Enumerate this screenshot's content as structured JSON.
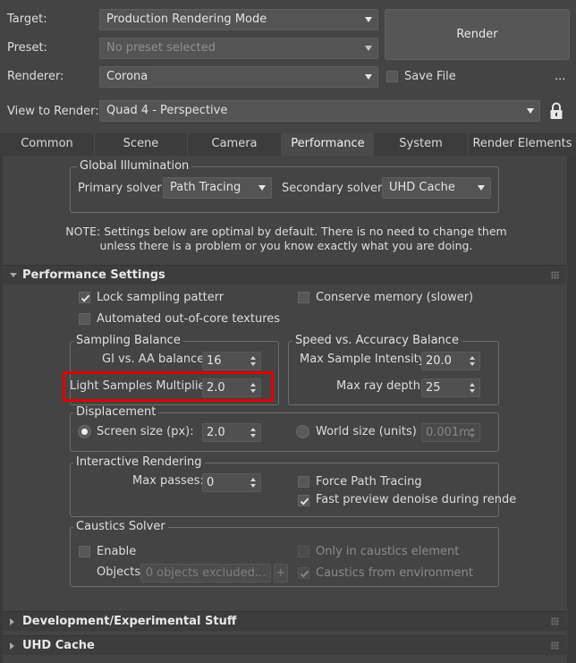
{
  "header": {
    "target_label": "Target:",
    "target_value": "Production Rendering Mode",
    "preset_label": "Preset:",
    "preset_value": "No preset selected",
    "renderer_label": "Renderer:",
    "renderer_value": "Corona",
    "view_label": "View to Render:",
    "view_value": "Quad 4 - Perspective",
    "render_button": "Render",
    "save_file_label": "Save File",
    "more_button": "..."
  },
  "tabs": [
    {
      "label": "Common",
      "active": false
    },
    {
      "label": "Scene",
      "active": false
    },
    {
      "label": "Camera",
      "active": false
    },
    {
      "label": "Performance",
      "active": true
    },
    {
      "label": "System",
      "active": false
    },
    {
      "label": "Render Elements",
      "active": false
    }
  ],
  "global_illumination": {
    "title": "Global Illumination",
    "primary_label": "Primary solver:",
    "primary_value": "Path Tracing",
    "secondary_label": "Secondary solver:",
    "secondary_value": "UHD Cache",
    "note_line1": "NOTE: Settings below are optimal by default. There is no need to change them",
    "note_line2": "unless there is a problem or you know exactly what you are doing."
  },
  "performance_settings": {
    "title": "Performance Settings",
    "lock_sampling_label": "Lock sampling patterr",
    "lock_sampling_checked": true,
    "conserve_memory_label": "Conserve memory (slower)",
    "conserve_memory_checked": false,
    "out_of_core_label": "Automated out-of-core textures",
    "out_of_core_checked": false,
    "sampling_balance": {
      "title": "Sampling Balance",
      "gi_aa_label": "GI vs. AA balance:",
      "gi_aa_value": "16",
      "light_samples_label": "Light Samples Multiplier:",
      "light_samples_value": "2.0"
    },
    "speed_accuracy": {
      "title": "Speed vs. Accuracy Balance",
      "max_sample_label": "Max Sample Intensity:",
      "max_sample_value": "20.0",
      "max_ray_label": "Max ray depth:",
      "max_ray_value": "25"
    },
    "displacement": {
      "title": "Displacement",
      "screen_size_label": "Screen size (px):",
      "screen_size_value": "2.0",
      "world_size_label": "World size (units)",
      "world_size_value": "0.001m"
    },
    "interactive_rendering": {
      "title": "Interactive Rendering",
      "max_passes_label": "Max passes:",
      "max_passes_value": "0",
      "force_path_label": "Force Path Tracing",
      "fast_preview_label": "Fast preview denoise during rende"
    },
    "caustics": {
      "title": "Caustics Solver",
      "enable_label": "Enable",
      "only_caustics_label": "Only in caustics element",
      "objects_label": "Objects:",
      "objects_button": "0 objects excluded...",
      "plus_button": "+",
      "from_env_label": "Caustics from environment"
    }
  },
  "rollouts": {
    "development_title": "Development/Experimental Stuff",
    "uhd_cache_title": "UHD Cache"
  },
  "colors": {
    "background": "#444444",
    "highlight_red": "#e00000"
  }
}
